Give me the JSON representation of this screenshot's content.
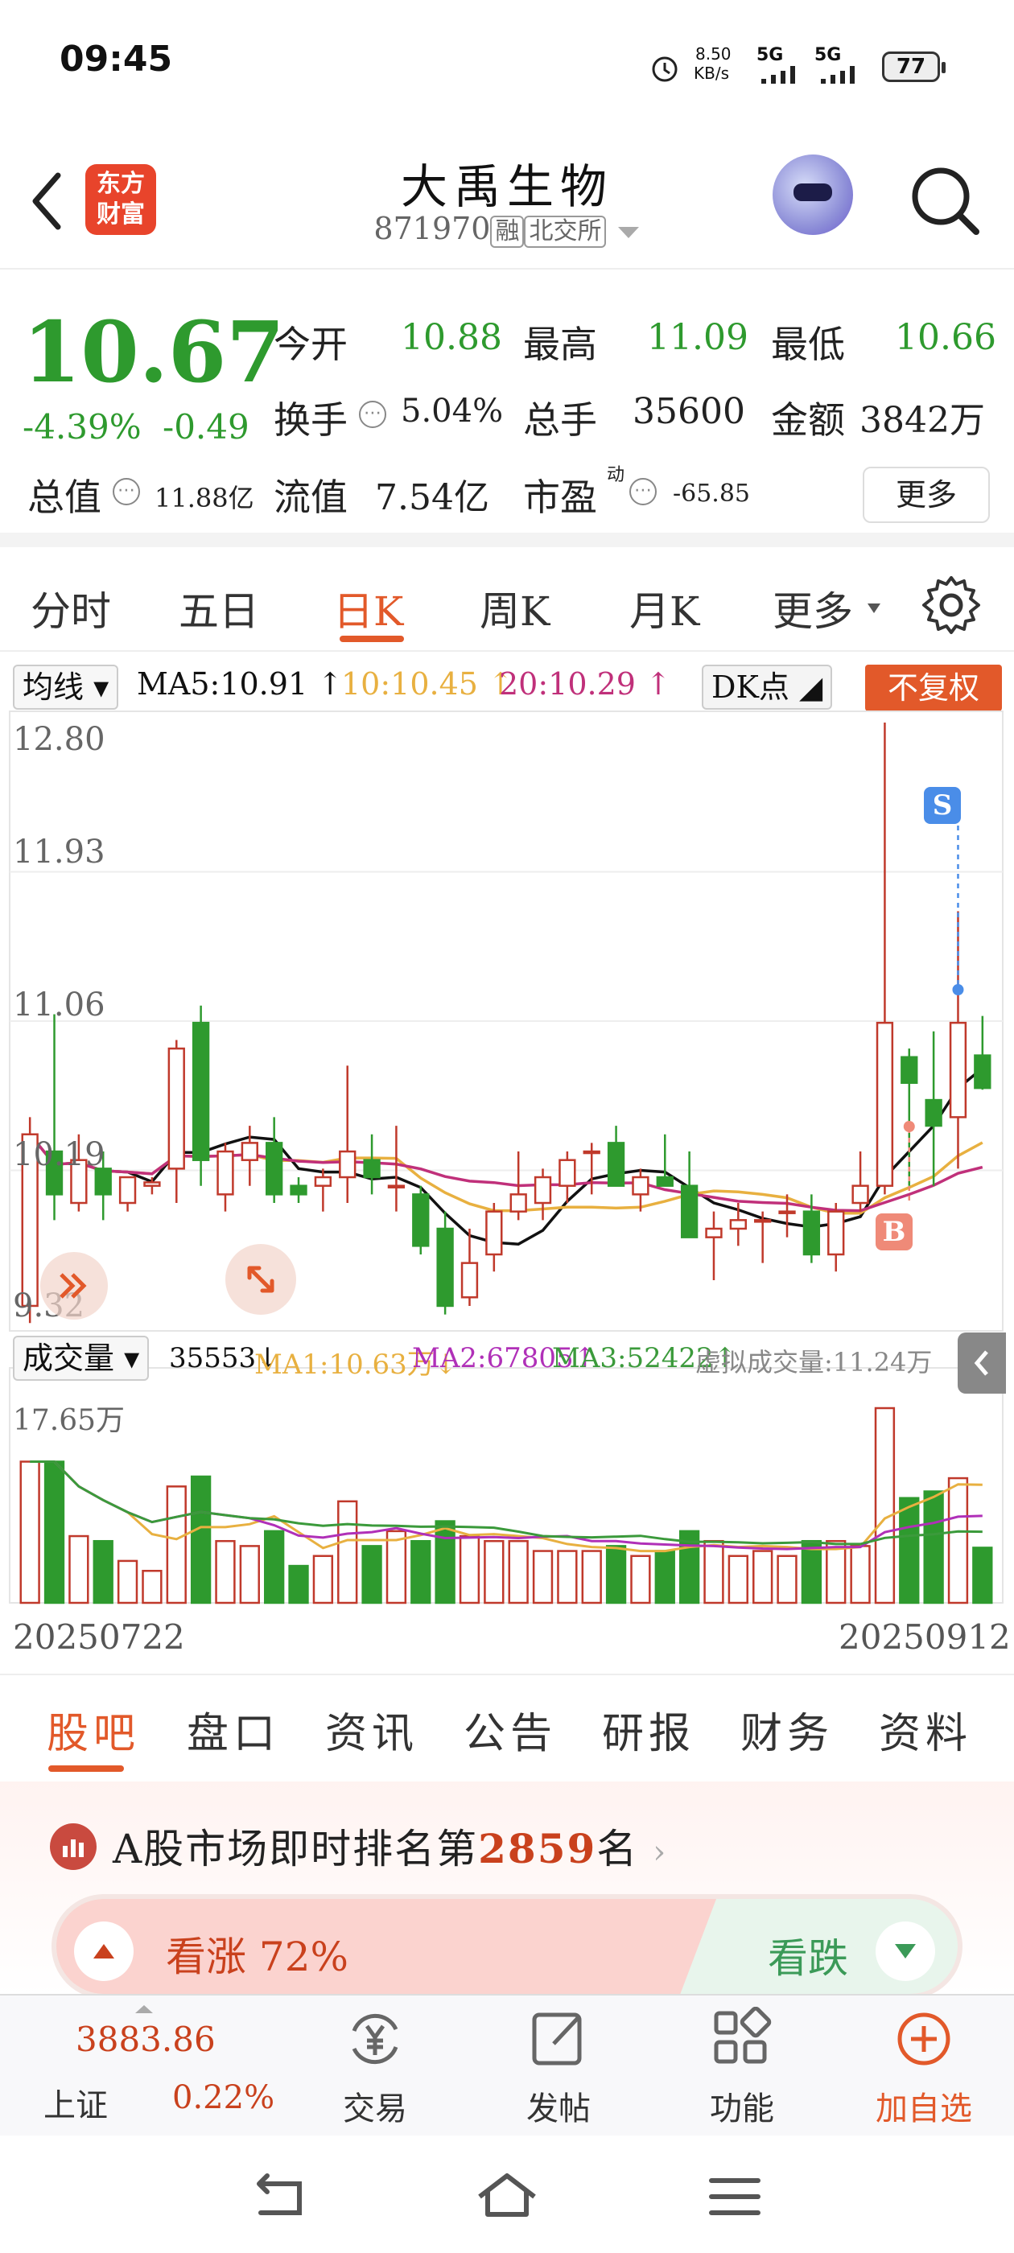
{
  "status_bar": {
    "time": "09:45",
    "net_speed": "8.50",
    "net_unit": "KB/s",
    "signal1": "5G",
    "signal2": "5G",
    "battery": "77"
  },
  "header": {
    "logo_line1": "东方",
    "logo_line2": "财富",
    "stock_name": "大禹生物",
    "stock_code": "871970",
    "tag_margin": "融",
    "tag_exchange": "北交所"
  },
  "quote": {
    "price": "10.67",
    "change_pct": "-4.39%",
    "change_abs": "-0.49",
    "open_label": "今开",
    "open": "10.88",
    "high_label": "最高",
    "high": "11.09",
    "low_label": "最低",
    "low": "10.66",
    "turnover_label": "换手",
    "turnover": "5.04%",
    "volume_label": "总手",
    "volume": "35600",
    "amount_label": "金额",
    "amount": "3842万",
    "mktcap_label": "总值",
    "mktcap": "11.88亿",
    "float_label": "流值",
    "float": "7.54亿",
    "pe_label": "市盈",
    "pe_sup": "动",
    "pe": "-65.85",
    "more_label": "更多"
  },
  "period_tabs": [
    "分时",
    "五日",
    "日K",
    "周K",
    "月K",
    "更多"
  ],
  "ma_legend": {
    "selector": "均线",
    "ma5": "MA5:10.91",
    "ma10": "10:10.45",
    "ma20": "20:10.29",
    "dk_label": "DK点",
    "adjust_label": "不复权",
    "colors": {
      "ma5": "#111111",
      "ma10": "#e8b040",
      "ma20": "#c0307a",
      "up": "#c0392b",
      "down": "#2e9a2e"
    }
  },
  "price_axis": [
    "12.80",
    "11.93",
    "11.06",
    "10.19",
    "9.32"
  ],
  "signals": {
    "sell": "S",
    "buy": "B"
  },
  "volume_legend": {
    "selector": "成交量",
    "vol": "35553",
    "ma1": "MA1:10.63万",
    "ma2": "MA2:67805",
    "ma3": "MA3:52422",
    "virtual": "虚拟成交量:11.24万",
    "axis_max": "17.65万"
  },
  "dates": {
    "start": "20250722",
    "end": "20250912"
  },
  "chart_data": {
    "type": "candlestick",
    "ylim": [
      9.32,
      12.8
    ],
    "candles": [
      {
        "o": 9.4,
        "h": 10.5,
        "l": 9.3,
        "c": 10.4
      },
      {
        "o": 10.3,
        "h": 11.1,
        "l": 9.9,
        "c": 10.05
      },
      {
        "o": 10.0,
        "h": 10.4,
        "l": 9.95,
        "c": 10.25
      },
      {
        "o": 10.2,
        "h": 10.3,
        "l": 9.9,
        "c": 10.05
      },
      {
        "o": 10.0,
        "h": 10.15,
        "l": 9.95,
        "c": 10.15
      },
      {
        "o": 10.1,
        "h": 10.15,
        "l": 10.05,
        "c": 10.12
      },
      {
        "o": 10.2,
        "h": 10.95,
        "l": 10.0,
        "c": 10.9
      },
      {
        "o": 11.05,
        "h": 11.15,
        "l": 10.1,
        "c": 10.25
      },
      {
        "o": 10.05,
        "h": 10.35,
        "l": 9.95,
        "c": 10.3
      },
      {
        "o": 10.25,
        "h": 10.45,
        "l": 10.1,
        "c": 10.35
      },
      {
        "o": 10.35,
        "h": 10.5,
        "l": 10.0,
        "c": 10.05
      },
      {
        "o": 10.1,
        "h": 10.15,
        "l": 10.0,
        "c": 10.05
      },
      {
        "o": 10.1,
        "h": 10.2,
        "l": 9.95,
        "c": 10.15
      },
      {
        "o": 10.15,
        "h": 10.8,
        "l": 10.0,
        "c": 10.3
      },
      {
        "o": 10.25,
        "h": 10.4,
        "l": 10.05,
        "c": 10.15
      },
      {
        "o": 10.1,
        "h": 10.45,
        "l": 9.95,
        "c": 10.1
      },
      {
        "o": 10.05,
        "h": 10.1,
        "l": 9.7,
        "c": 9.75
      },
      {
        "o": 9.85,
        "h": 9.95,
        "l": 9.35,
        "c": 9.4
      },
      {
        "o": 9.45,
        "h": 9.85,
        "l": 9.4,
        "c": 9.65
      },
      {
        "o": 9.7,
        "h": 10.0,
        "l": 9.6,
        "c": 9.95
      },
      {
        "o": 9.95,
        "h": 10.3,
        "l": 9.9,
        "c": 10.05
      },
      {
        "o": 10.0,
        "h": 10.2,
        "l": 9.9,
        "c": 10.15
      },
      {
        "o": 10.1,
        "h": 10.3,
        "l": 10.0,
        "c": 10.25
      },
      {
        "o": 10.3,
        "h": 10.35,
        "l": 10.05,
        "c": 10.3
      },
      {
        "o": 10.35,
        "h": 10.45,
        "l": 10.1,
        "c": 10.1
      },
      {
        "o": 10.05,
        "h": 10.2,
        "l": 9.95,
        "c": 10.15
      },
      {
        "o": 10.15,
        "h": 10.4,
        "l": 10.1,
        "c": 10.1
      },
      {
        "o": 10.1,
        "h": 10.3,
        "l": 9.8,
        "c": 9.8
      },
      {
        "o": 9.8,
        "h": 9.95,
        "l": 9.55,
        "c": 9.85
      },
      {
        "o": 9.85,
        "h": 10.0,
        "l": 9.75,
        "c": 9.9
      },
      {
        "o": 9.9,
        "h": 9.95,
        "l": 9.65,
        "c": 9.9
      },
      {
        "o": 9.95,
        "h": 10.05,
        "l": 9.8,
        "c": 9.95
      },
      {
        "o": 9.95,
        "h": 10.05,
        "l": 9.65,
        "c": 9.7
      },
      {
        "o": 9.7,
        "h": 10.0,
        "l": 9.6,
        "c": 9.95
      },
      {
        "o": 10.0,
        "h": 10.3,
        "l": 9.95,
        "c": 10.1
      },
      {
        "o": 10.1,
        "h": 12.8,
        "l": 10.05,
        "c": 11.05
      },
      {
        "o": 10.85,
        "h": 10.9,
        "l": 10.1,
        "c": 10.7
      },
      {
        "o": 10.6,
        "h": 11.0,
        "l": 10.1,
        "c": 10.45
      },
      {
        "o": 10.5,
        "h": 11.7,
        "l": 10.2,
        "c": 11.05
      },
      {
        "o": 10.86,
        "h": 11.09,
        "l": 10.66,
        "c": 10.67
      }
    ],
    "volume_max": 17.65
  },
  "info_tabs": [
    "股吧",
    "盘口",
    "资讯",
    "公告",
    "研报",
    "财务",
    "资料"
  ],
  "ranking": {
    "prefix": "A股市场即时排名第",
    "rank": "2859",
    "suffix": "名"
  },
  "vote": {
    "up_label": "看涨 72%",
    "down_label": "看跌",
    "up_pct": 72
  },
  "bottom_bar": {
    "index_value": "3883.86",
    "index_name": "上证",
    "index_change": "0.22%",
    "trade": "交易",
    "post": "发帖",
    "function": "功能",
    "add_watch": "加自选"
  }
}
